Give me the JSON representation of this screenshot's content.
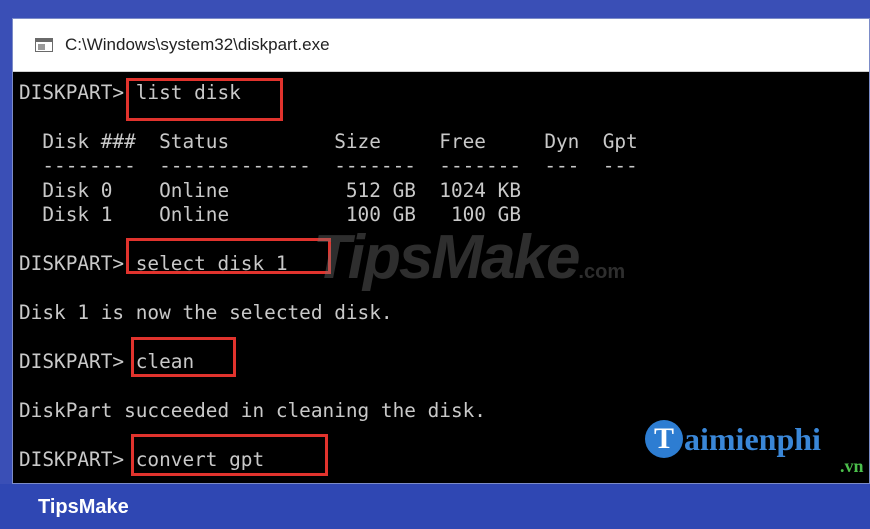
{
  "window": {
    "title": "C:\\Windows\\system32\\diskpart.exe"
  },
  "console": {
    "lines": [
      "DISKPART> list disk",
      "",
      "  Disk ###  Status         Size     Free     Dyn  Gpt",
      "  --------  -------------  -------  -------  ---  ---",
      "  Disk 0    Online          512 GB  1024 KB",
      "  Disk 1    Online          100 GB   100 GB",
      "",
      "DISKPART> select disk 1",
      "",
      "Disk 1 is now the selected disk.",
      "",
      "DISKPART> clean",
      "",
      "DiskPart succeeded in cleaning the disk.",
      "",
      "DISKPART> convert gpt"
    ],
    "colors": {
      "background": "#000000",
      "text": "#c9c9c9",
      "highlight_border": "#e1332d"
    }
  },
  "watermark": {
    "text": "TipsMake",
    "suffix": ".com"
  },
  "logo": {
    "initial": "T",
    "word": "aimienphi",
    "domain": ".vn"
  },
  "footer": {
    "label": "TipsMake",
    "background": "#2f47b3"
  }
}
